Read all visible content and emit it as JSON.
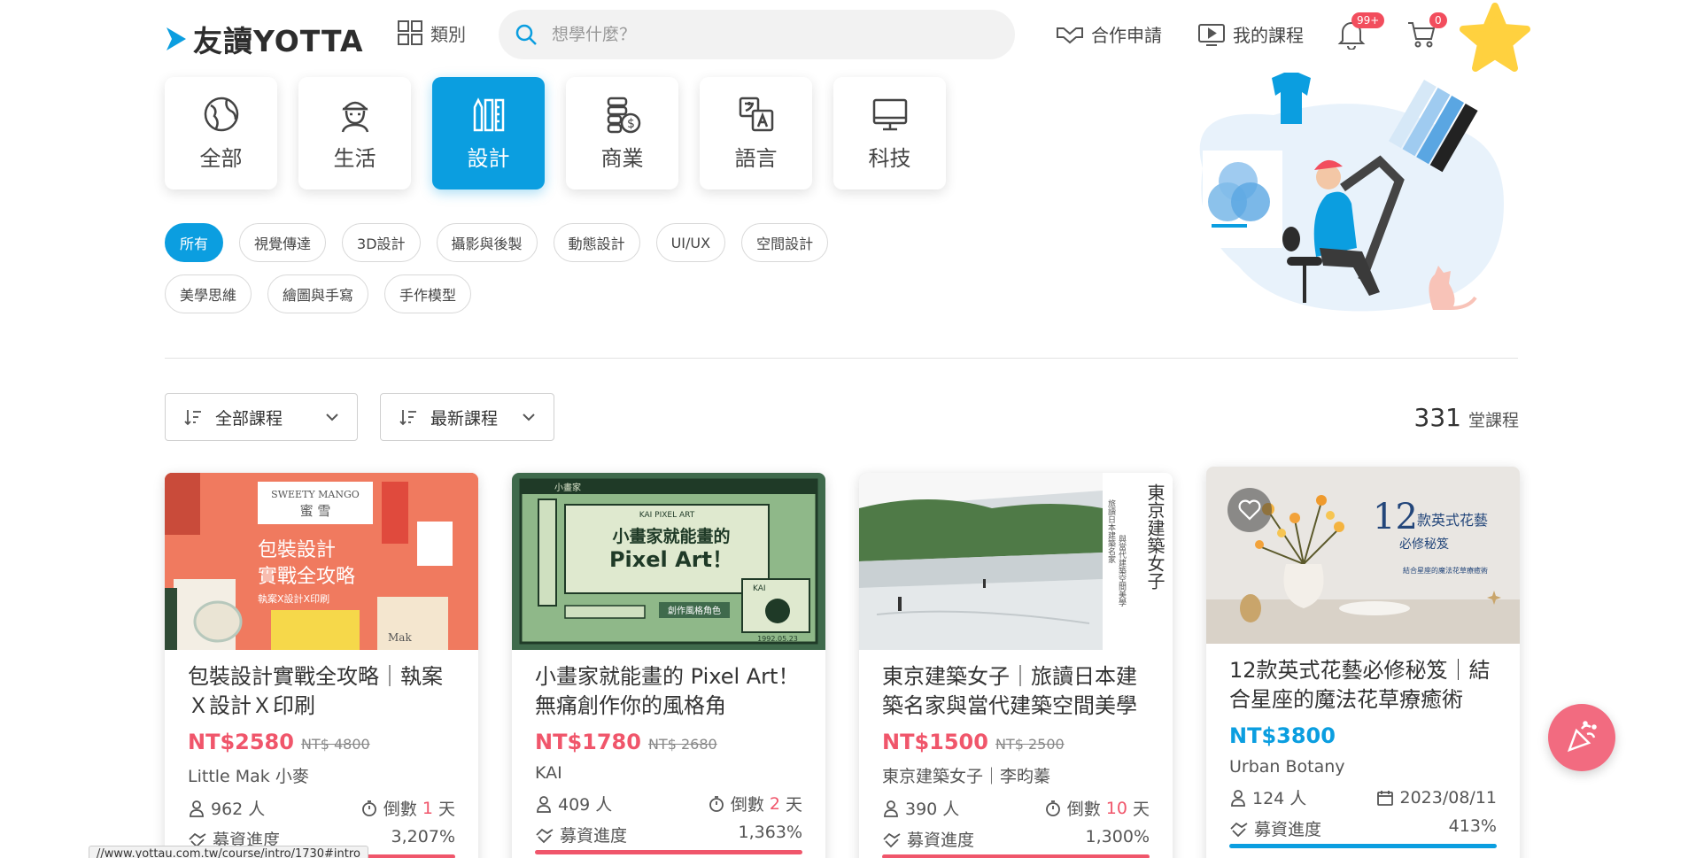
{
  "header": {
    "logo_text": "友讀YOTTA",
    "categories_label": "類別",
    "search_placeholder": "想學什麼？",
    "partner_label": "合作申請",
    "my_courses_label": "我的課程",
    "notif_badge": "99+",
    "cart_badge": "0"
  },
  "tiles": [
    {
      "label": "全部",
      "icon": "globe-icon"
    },
    {
      "label": "生活",
      "icon": "person-icon"
    },
    {
      "label": "設計",
      "icon": "design-tools-icon",
      "active": true
    },
    {
      "label": "商業",
      "icon": "coins-icon"
    },
    {
      "label": "語言",
      "icon": "translate-icon"
    },
    {
      "label": "科技",
      "icon": "monitor-icon"
    }
  ],
  "chips": [
    "所有",
    "視覺傳達",
    "3D設計",
    "攝影與後製",
    "動態設計",
    "UI/UX",
    "空間設計",
    "美學思維",
    "繪圖與手寫",
    "手作模型"
  ],
  "sort": {
    "filter_label": "全部課程",
    "order_label": "最新課程"
  },
  "count": {
    "num": "331",
    "unit": "堂課程"
  },
  "cards": [
    {
      "title": "包裝設計實戰全攻略｜執案Ｘ設計Ｘ印刷",
      "price": "NT$2580",
      "orig": "NT$ 4800",
      "teacher": "Little Mak 小麥",
      "people": "962 人",
      "countdown_pre": "倒數",
      "countdown_num": "1",
      "countdown_unit": "天",
      "progress_label": "募資進度",
      "progress": "3,207%"
    },
    {
      "title": "小畫家就能畫的 Pixel Art！無痛創作你的風格角",
      "price": "NT$1780",
      "orig": "NT$ 2680",
      "teacher": "KAI",
      "people": "409 人",
      "countdown_pre": "倒數",
      "countdown_num": "2",
      "countdown_unit": "天",
      "progress_label": "募資進度",
      "progress": "1,363%"
    },
    {
      "title": "東京建築女子｜旅讀日本建築名家與當代建築空間美學",
      "price": "NT$1500",
      "orig": "NT$ 2500",
      "teacher": "東京建築女子｜李昀蓁",
      "people": "390 人",
      "countdown_pre": "倒數",
      "countdown_num": "10",
      "countdown_unit": "天",
      "progress_label": "募資進度",
      "progress": "1,300%"
    },
    {
      "title": "12款英式花藝必修秘笈｜結合星座的魔法花草療癒術",
      "price": "NT$3800",
      "teacher": "Urban Botany",
      "people": "124 人",
      "date": "2023/08/11",
      "progress_label": "募資進度",
      "progress": "413%"
    }
  ],
  "card_images": {
    "c1_line1": "包裝設計",
    "c1_line2": "實戰全攻略",
    "c1_sub": "執案X設計X印刷",
    "c1_brand": "SWEETY MANGO",
    "c1_brand2": "蜜 雪",
    "c1_mak": "Mak",
    "c2_title1": "小畫家就能畫的",
    "c2_title2": "Pixel Art！",
    "c2_top": "KAI PIXEL ART",
    "c2_win": "小畫家",
    "c2_btn": "創作風格角色",
    "c2_kai": "KAI",
    "c2_date": "1992.05.23",
    "c3_title": "東京建築女子",
    "c3_sub1": "旅讀日本建築名家",
    "c3_sub2": "與當代建築空間美學",
    "c4_title1": "12",
    "c4_title2": "款英式花藝",
    "c4_title3": "必修秘笈",
    "c4_sub": "結合星座的魔法花草療癒術"
  },
  "status_url": "//www.yottau.com.tw/course/intro/1730#intro",
  "colors": {
    "accent": "#0b9ee0",
    "price": "#f0566b",
    "badge": "#f24d5d"
  }
}
